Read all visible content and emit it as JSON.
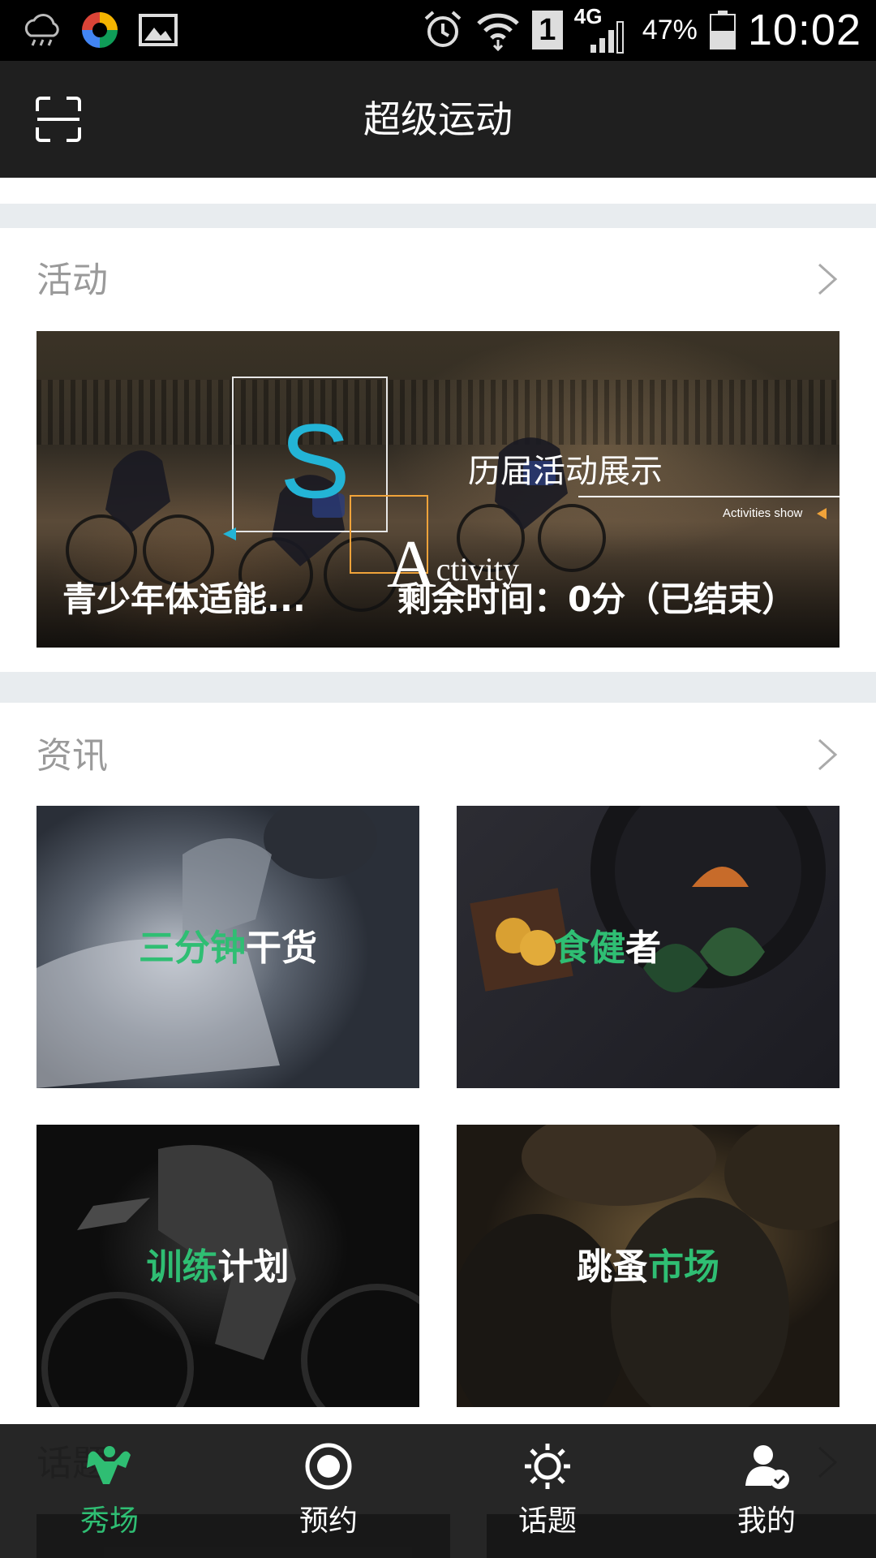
{
  "status_bar": {
    "network": "4G",
    "sim_slot": "1",
    "battery": "47%",
    "time": "10:02"
  },
  "header": {
    "title": "超级运动",
    "scan_icon": "scan-icon"
  },
  "activity_section": {
    "title": "活动",
    "banner": {
      "big_letter": "S",
      "activity_cap": "A",
      "activity_rest": "ctivity",
      "history_label": "历届活动展示",
      "activities_show": "Activities show",
      "event_name": "青少年体适能...",
      "remaining_time": "剩余时间：0分（已结束）"
    }
  },
  "news_section": {
    "title": "资讯",
    "tiles": [
      {
        "green": "三分钟",
        "white": "干货"
      },
      {
        "green": "食健",
        "white": "者"
      },
      {
        "green": "训练",
        "white": "计划"
      },
      {
        "white": "跳蚤",
        "green": "市场"
      }
    ]
  },
  "topics_section": {
    "title": "话题"
  },
  "tab_bar": {
    "items": [
      {
        "label": "秀场",
        "icon": "muscle-icon",
        "active": true
      },
      {
        "label": "预约",
        "icon": "record-icon",
        "active": false
      },
      {
        "label": "话题",
        "icon": "sun-icon",
        "active": false
      },
      {
        "label": "我的",
        "icon": "user-check-icon",
        "active": false
      }
    ]
  },
  "colors": {
    "accent": "#2fbe73",
    "header_bg": "#1f1f1f",
    "section_gap": "#e8ecef",
    "cyan": "#23b4d6",
    "orange": "#f0a33a"
  }
}
